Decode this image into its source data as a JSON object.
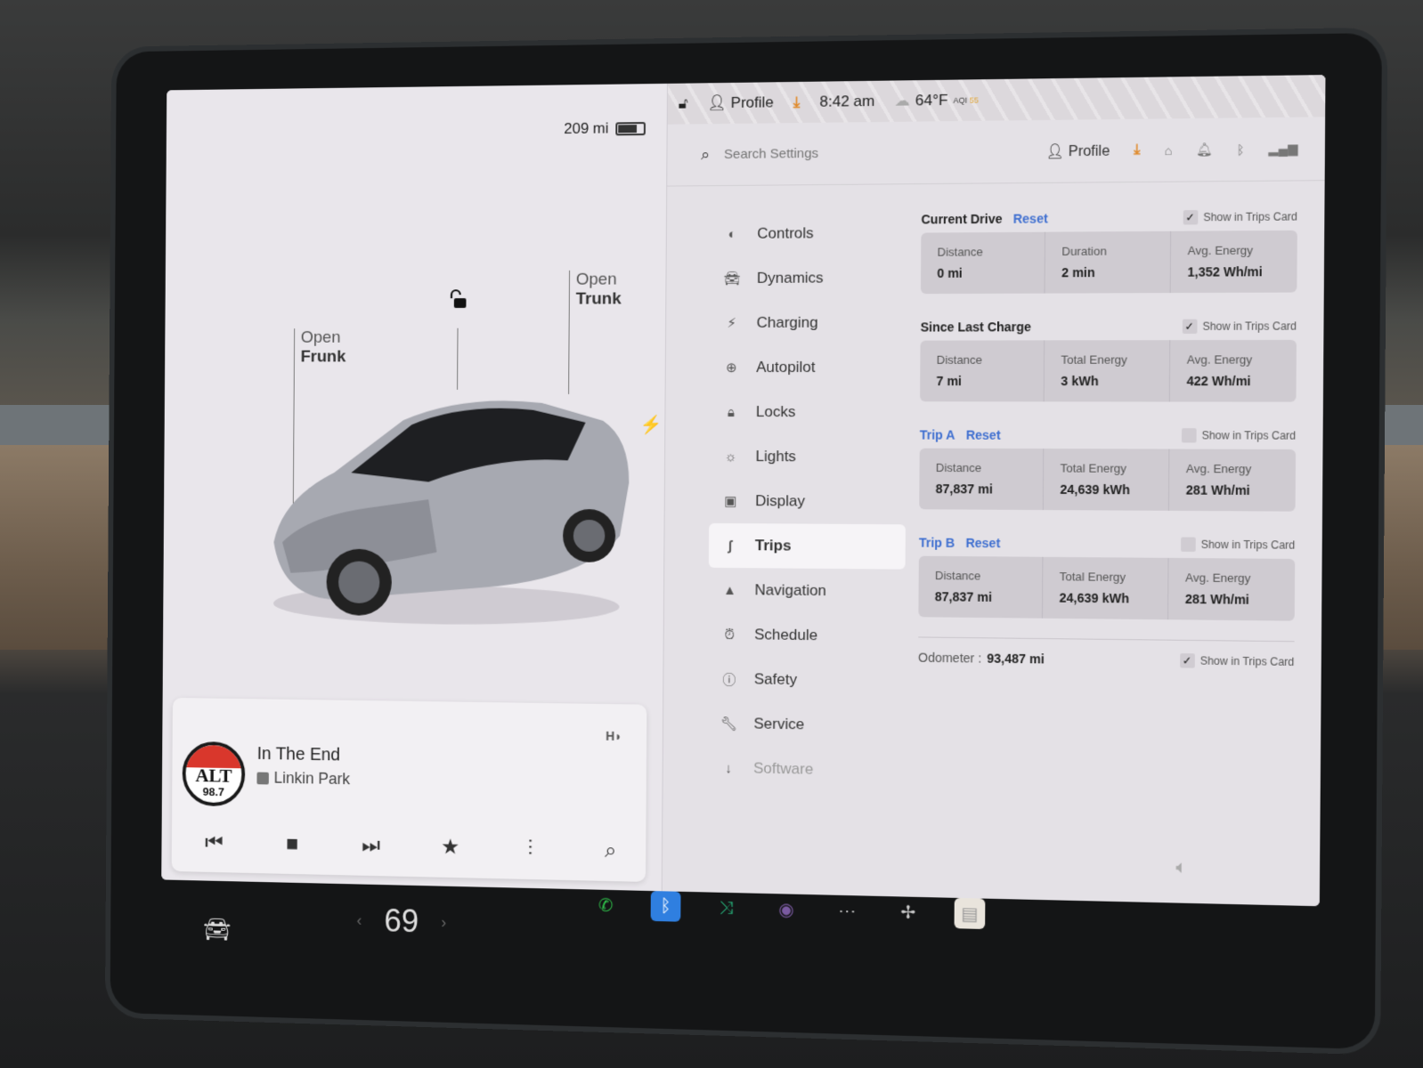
{
  "vehicle": {
    "range": "209 mi",
    "battery_level": 0.75,
    "callouts": {
      "frunk_top": "Open",
      "frunk_bottom": "Frunk",
      "trunk_top": "Open",
      "trunk_bottom": "Trunk"
    }
  },
  "media": {
    "station_name": "ALT",
    "station_freq": "98.7",
    "song": "In The End",
    "artist": "Linkin Park",
    "hd_label": "HD"
  },
  "status_bar": {
    "profile": "Profile",
    "time": "8:42 am",
    "temperature": "64°F",
    "aqi_label": "AQI",
    "aqi_value": "55"
  },
  "settings": {
    "search_placeholder": "Search Settings",
    "profile_label": "Profile",
    "nav_items": [
      {
        "label": "Controls",
        "icon": "toggle-icon"
      },
      {
        "label": "Dynamics",
        "icon": "car-icon"
      },
      {
        "label": "Charging",
        "icon": "bolt-icon"
      },
      {
        "label": "Autopilot",
        "icon": "steering-wheel-icon"
      },
      {
        "label": "Locks",
        "icon": "lock-icon"
      },
      {
        "label": "Lights",
        "icon": "light-icon"
      },
      {
        "label": "Display",
        "icon": "display-icon"
      },
      {
        "label": "Trips",
        "icon": "trips-icon",
        "active": true
      },
      {
        "label": "Navigation",
        "icon": "navigation-icon"
      },
      {
        "label": "Schedule",
        "icon": "alarm-icon"
      },
      {
        "label": "Safety",
        "icon": "alert-icon"
      },
      {
        "label": "Service",
        "icon": "wrench-icon"
      },
      {
        "label": "Software",
        "icon": "download-icon"
      }
    ],
    "trips": {
      "current_drive": {
        "title": "Current Drive",
        "reset": "Reset",
        "show_in_card": "Show in Trips Card",
        "checked": true,
        "cells": [
          {
            "k": "Distance",
            "v": "0 mi"
          },
          {
            "k": "Duration",
            "v": "2 min"
          },
          {
            "k": "Avg. Energy",
            "v": "1,352 Wh/mi"
          }
        ]
      },
      "since_last_charge": {
        "title": "Since Last Charge",
        "show_in_card": "Show in Trips Card",
        "checked": true,
        "cells": [
          {
            "k": "Distance",
            "v": "7 mi"
          },
          {
            "k": "Total Energy",
            "v": "3 kWh"
          },
          {
            "k": "Avg. Energy",
            "v": "422 Wh/mi"
          }
        ]
      },
      "trip_a": {
        "title": "Trip A",
        "reset": "Reset",
        "show_in_card": "Show in Trips Card",
        "checked": false,
        "cells": [
          {
            "k": "Distance",
            "v": "87,837 mi"
          },
          {
            "k": "Total Energy",
            "v": "24,639 kWh"
          },
          {
            "k": "Avg. Energy",
            "v": "281 Wh/mi"
          }
        ]
      },
      "trip_b": {
        "title": "Trip B",
        "reset": "Reset",
        "show_in_card": "Show in Trips Card",
        "checked": false,
        "cells": [
          {
            "k": "Distance",
            "v": "87,837 mi"
          },
          {
            "k": "Total Energy",
            "v": "24,639 kWh"
          },
          {
            "k": "Avg. Energy",
            "v": "281 Wh/mi"
          }
        ]
      },
      "odometer": {
        "label": "Odometer :",
        "value": "93,487 mi",
        "show_in_card": "Show in Trips Card",
        "checked": true
      }
    }
  },
  "taskbar": {
    "cabin_temp": "69",
    "apps": [
      "phone-icon",
      "bluetooth-icon",
      "shuffle-icon",
      "camera-icon",
      "more-icon",
      "fan-icon",
      "notes-icon"
    ],
    "colors": {
      "phone": "#2fbf4a",
      "bluetooth": "#2f7fe0",
      "shuffle": "#27b07a"
    }
  }
}
